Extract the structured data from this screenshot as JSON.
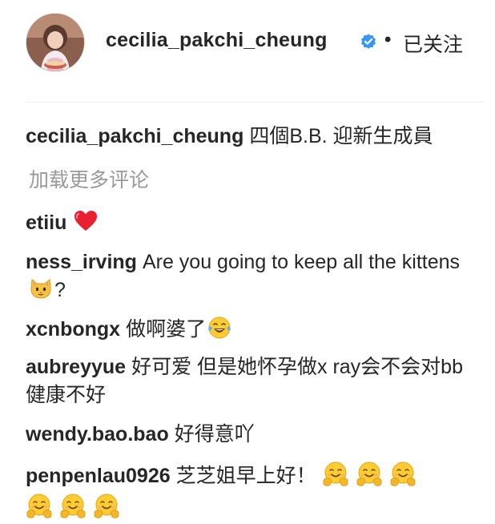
{
  "post_header": {
    "username": "cecilia_pakchi_cheung",
    "verified_icon": "verified-badge-icon",
    "separator": "•",
    "follow_status": "已关注"
  },
  "caption": {
    "username": "cecilia_pakchi_cheung",
    "text": "四個B.B. 迎新生成員"
  },
  "load_more_comments": "加载更多评论",
  "comments": [
    {
      "username": "etiiu",
      "text": "",
      "emojis": [
        "red-heart-icon"
      ]
    },
    {
      "username": "ness_irving",
      "text": "Are you going to keep all the kittens",
      "emojis": [
        "cat-face-icon"
      ],
      "suffix": "?"
    },
    {
      "username": "xcnbongx",
      "text": "做啊婆了",
      "emojis": [
        "tears-of-joy-icon"
      ]
    },
    {
      "username": "aubreyyue",
      "text": "好可爱 但是她怀孕做x ray会不会对bb健康不好"
    },
    {
      "username": "wendy.bao.bao",
      "text": "好得意吖"
    },
    {
      "username": "penpenlau0926",
      "text": "芝芝姐早上好！",
      "emojis": [
        "hugging-face-icon",
        "hugging-face-icon",
        "hugging-face-icon",
        "hugging-face-icon",
        "hugging-face-icon",
        "hugging-face-icon"
      ]
    }
  ],
  "colors": {
    "text": "#262626",
    "muted": "#999999",
    "verified": "#3897f0",
    "divider": "#efefef"
  }
}
